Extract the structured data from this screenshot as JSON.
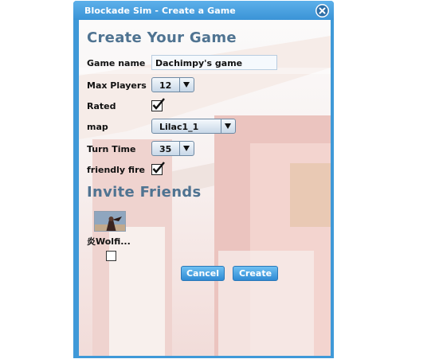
{
  "window": {
    "title": "Blockade Sim - Create a Game",
    "close_icon": "close-icon"
  },
  "form": {
    "heading": "Create Your Game",
    "game_name_label": "Game name",
    "game_name_value": "Dachimpy's game",
    "max_players_label": "Max Players",
    "max_players_value": "12",
    "rated_label": "Rated",
    "rated_checked": true,
    "map_label": "map",
    "map_value": "Lilac1_1",
    "turn_time_label": "Turn Time",
    "turn_time_value": "35",
    "friendly_fire_label": "friendly fire",
    "friendly_fire_checked": true
  },
  "invite": {
    "heading": "Invite Friends",
    "friends": [
      {
        "name": "炎Wolfi...",
        "selected": false
      }
    ]
  },
  "buttons": {
    "cancel": "Cancel",
    "create": "Create"
  },
  "colors": {
    "window_frame": "#3f99d8",
    "heading": "#4f7391",
    "button": "#3a96dc"
  }
}
